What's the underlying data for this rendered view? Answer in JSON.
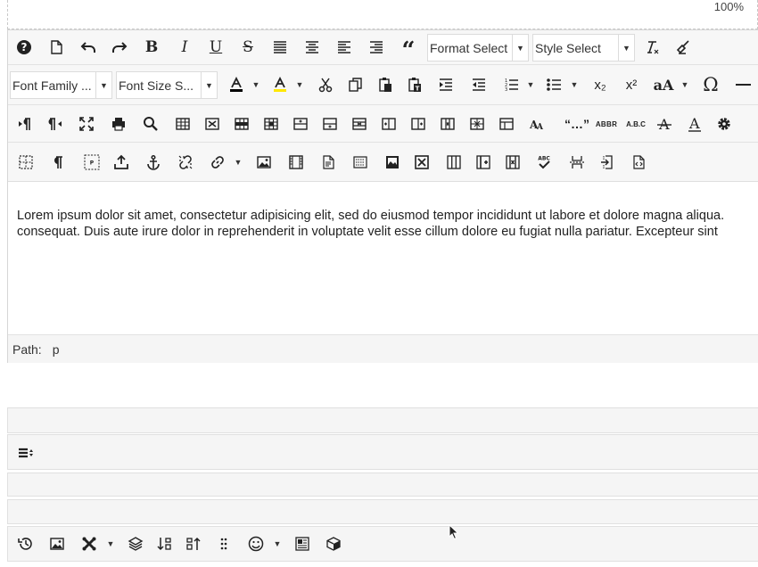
{
  "zoom": "100%",
  "toolbar": {
    "format_select": "Format Select",
    "style_select": "Style Select",
    "font_family": "Font Family ...",
    "font_size": "Font Size S...",
    "bold": "B",
    "italic": "I",
    "underline": "U",
    "strikethrough": "S",
    "quote": "“",
    "omega": "Ω",
    "font_case": "aA",
    "subscript": "x₂",
    "superscript": "x²",
    "abbr": "ABBR",
    "acronym": "A.B.C",
    "citation": "“…”",
    "spellcheck": "ABC"
  },
  "content": {
    "line1": "Lorem ipsum dolor sit amet, consectetur adipisicing elit, sed do eiusmod tempor incididunt ut labore et dolore magna aliqua.",
    "line2": "consequat. Duis aute irure dolor in reprehenderit in voluptate velit esse cillum dolore eu fugiat nulla pariatur. Excepteur sint"
  },
  "path": {
    "label": "Path:",
    "value": "p"
  },
  "colors": {
    "text_color_bar": "#000000",
    "highlight_bar": "#ffe800",
    "toolbar_bg": "#f7f7f7"
  }
}
